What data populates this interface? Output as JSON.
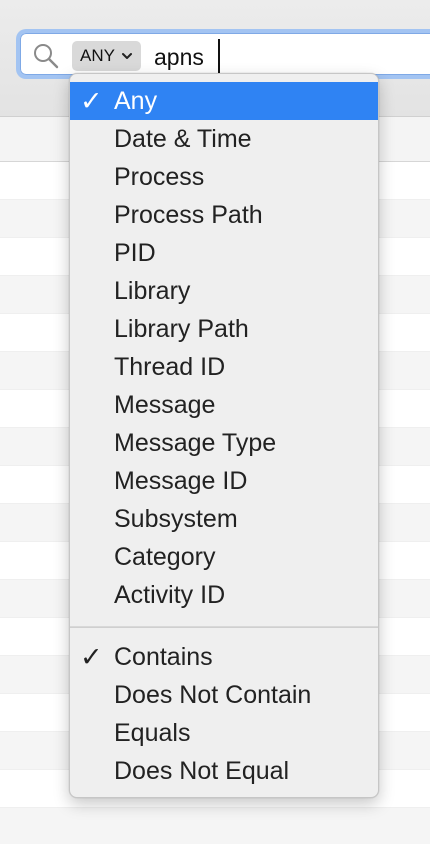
{
  "search": {
    "field_selector": "ANY",
    "query": "apns"
  },
  "menu": {
    "fields": [
      {
        "label": "Any",
        "checked": true,
        "highlighted": true
      },
      {
        "label": "Date & Time"
      },
      {
        "label": "Process"
      },
      {
        "label": "Process Path"
      },
      {
        "label": "PID"
      },
      {
        "label": "Library"
      },
      {
        "label": "Library Path"
      },
      {
        "label": "Thread ID"
      },
      {
        "label": "Message"
      },
      {
        "label": "Message Type"
      },
      {
        "label": "Message ID"
      },
      {
        "label": "Subsystem"
      },
      {
        "label": "Category"
      },
      {
        "label": "Activity ID"
      }
    ],
    "operators": [
      {
        "label": "Contains",
        "checked": true
      },
      {
        "label": "Does Not Contain"
      },
      {
        "label": "Equals"
      },
      {
        "label": "Does Not Equal"
      }
    ],
    "check_glyph": "✓"
  },
  "colors": {
    "highlight": "#2f83f3",
    "focus_ring": "#a3c4f2"
  }
}
